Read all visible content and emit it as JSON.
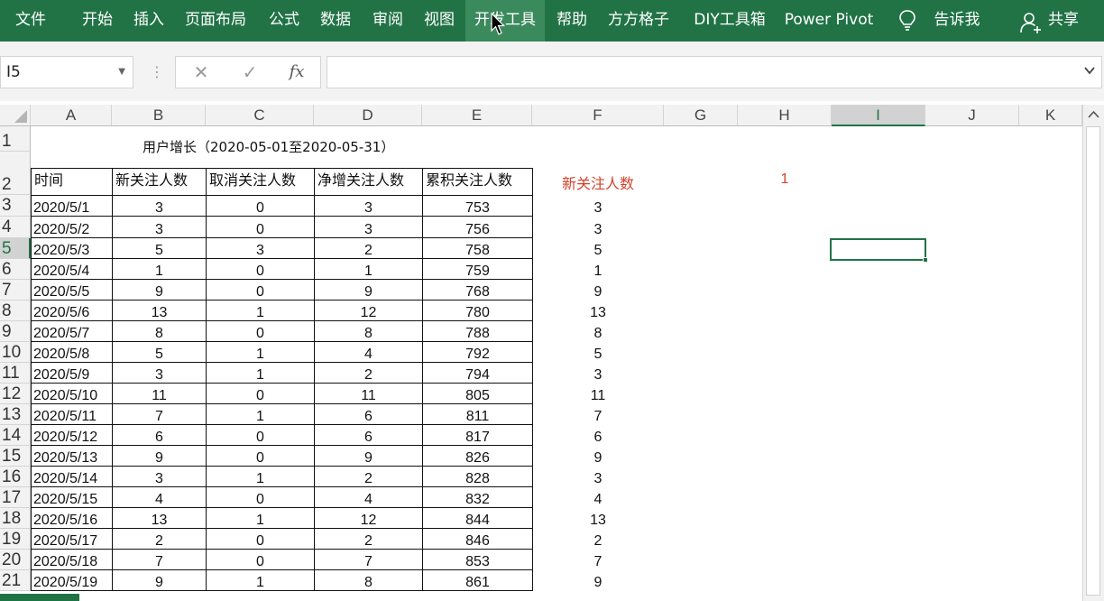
{
  "ribbon": {
    "tabs": [
      "文件",
      "开始",
      "插入",
      "页面布局",
      "公式",
      "数据",
      "审阅",
      "视图",
      "开发工具",
      "帮助",
      "方方格子",
      "DIY工具箱",
      "Power Pivot",
      "告诉我",
      "共享"
    ],
    "active_tab": "开发工具",
    "tell_me_icon": "lightbulb-icon",
    "share_icon": "user-add-icon"
  },
  "formula_bar": {
    "name_box": "I5",
    "cancel_icon": "cancel-icon",
    "enter_icon": "check-icon",
    "fx_label": "fx",
    "formula": ""
  },
  "columns": [
    "A",
    "B",
    "C",
    "D",
    "E",
    "F",
    "G",
    "H",
    "I",
    "J",
    "K"
  ],
  "rows": [
    "1",
    "2",
    "3",
    "4",
    "5",
    "6",
    "7",
    "8",
    "9",
    "10",
    "11",
    "12",
    "13",
    "14",
    "15",
    "16",
    "17",
    "18",
    "19",
    "20",
    "21"
  ],
  "selected_cell": "I5",
  "sheet": {
    "title": "用户增长（2020-05-01至2020-05-31）",
    "headers": [
      "时间",
      "新关注人数",
      "取消关注人数",
      "净增关注人数",
      "累积关注人数"
    ],
    "table": [
      [
        "2020/5/1",
        "3",
        "0",
        "3",
        "753"
      ],
      [
        "2020/5/2",
        "3",
        "0",
        "3",
        "756"
      ],
      [
        "2020/5/3",
        "5",
        "3",
        "2",
        "758"
      ],
      [
        "2020/5/4",
        "1",
        "0",
        "1",
        "759"
      ],
      [
        "2020/5/5",
        "9",
        "0",
        "9",
        "768"
      ],
      [
        "2020/5/6",
        "13",
        "1",
        "12",
        "780"
      ],
      [
        "2020/5/7",
        "8",
        "0",
        "8",
        "788"
      ],
      [
        "2020/5/8",
        "5",
        "1",
        "4",
        "792"
      ],
      [
        "2020/5/9",
        "3",
        "1",
        "2",
        "794"
      ],
      [
        "2020/5/10",
        "11",
        "0",
        "11",
        "805"
      ],
      [
        "2020/5/11",
        "7",
        "1",
        "6",
        "811"
      ],
      [
        "2020/5/12",
        "6",
        "0",
        "6",
        "817"
      ],
      [
        "2020/5/13",
        "9",
        "0",
        "9",
        "826"
      ],
      [
        "2020/5/14",
        "3",
        "1",
        "2",
        "828"
      ],
      [
        "2020/5/15",
        "4",
        "0",
        "4",
        "832"
      ],
      [
        "2020/5/16",
        "13",
        "1",
        "12",
        "844"
      ],
      [
        "2020/5/17",
        "2",
        "0",
        "2",
        "846"
      ],
      [
        "2020/5/18",
        "7",
        "0",
        "7",
        "853"
      ],
      [
        "2020/5/19",
        "9",
        "1",
        "8",
        "861"
      ]
    ],
    "lookup_label": "新关注人数",
    "lookup_value": "1",
    "lookup_results": [
      "3",
      "3",
      "5",
      "1",
      "9",
      "13",
      "8",
      "5",
      "3",
      "11",
      "7",
      "6",
      "9",
      "3",
      "4",
      "13",
      "2",
      "7",
      "9"
    ],
    "accent_color": "#d2422c"
  },
  "colors": {
    "ribbon": "#217346",
    "selection": "#217346"
  }
}
